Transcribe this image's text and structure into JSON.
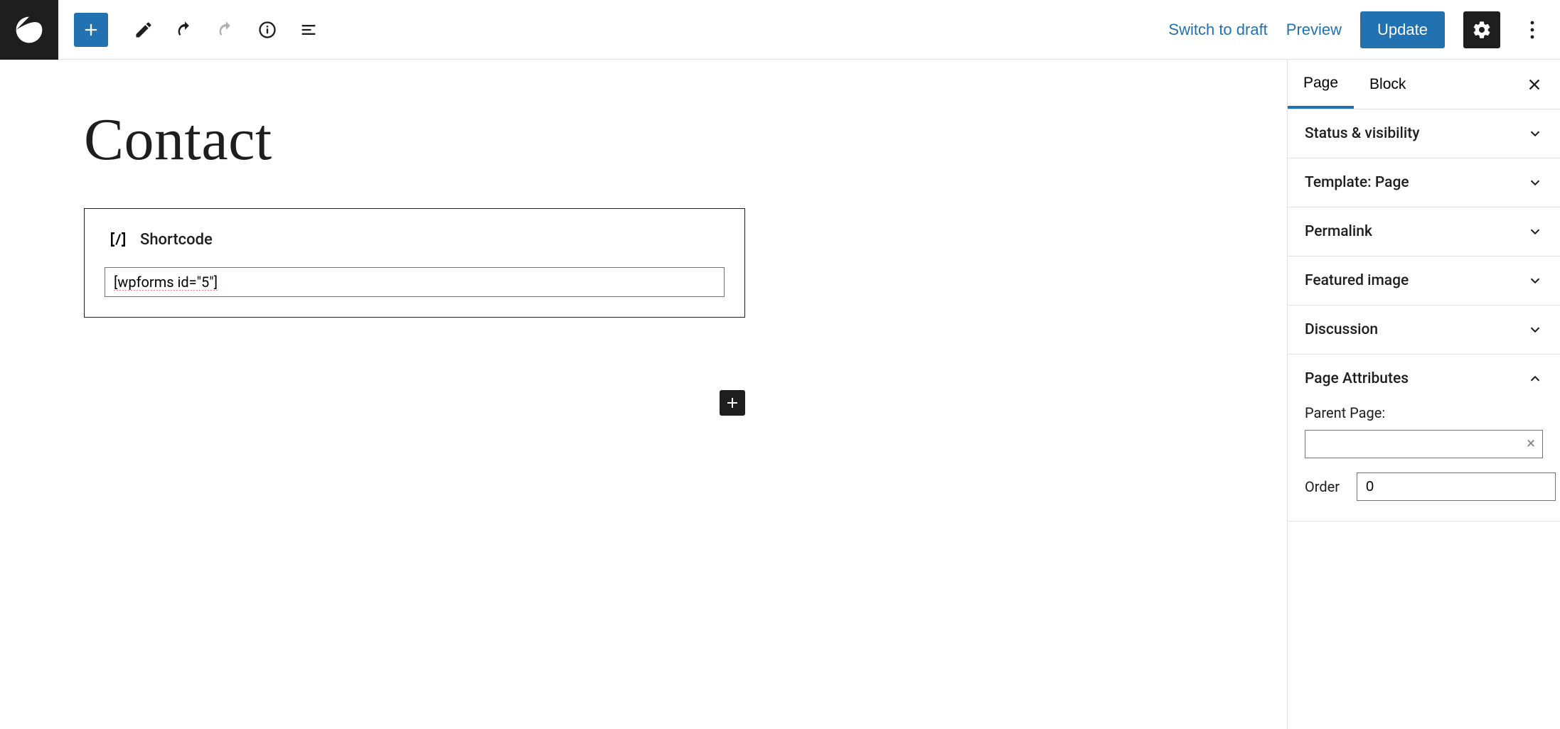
{
  "toolbar": {
    "switch_to_draft": "Switch to draft",
    "preview": "Preview",
    "update": "Update"
  },
  "editor": {
    "page_title": "Contact",
    "shortcode_label": "Shortcode",
    "shortcode_value": "[wpforms id=\"5\"]"
  },
  "sidebar": {
    "tabs": {
      "page": "Page",
      "block": "Block"
    },
    "panels": {
      "status": "Status & visibility",
      "template": "Template: Page",
      "permalink": "Permalink",
      "featured": "Featured image",
      "discussion": "Discussion",
      "attributes": "Page Attributes"
    },
    "attributes": {
      "parent_label": "Parent Page:",
      "parent_value": "",
      "order_label": "Order",
      "order_value": "0"
    }
  }
}
